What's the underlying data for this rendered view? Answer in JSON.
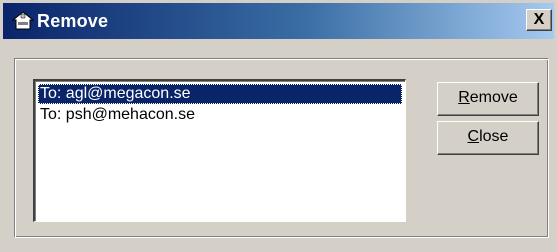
{
  "window": {
    "title": "Remove",
    "close_glyph": "X",
    "icon": "remove-user-icon"
  },
  "list": {
    "items": [
      {
        "label": "To: agl@megacon.se",
        "selected": true
      },
      {
        "label": "To: psh@mehacon.se",
        "selected": false
      }
    ]
  },
  "buttons": {
    "remove": {
      "accel": "R",
      "rest": "emove"
    },
    "close": {
      "accel": "C",
      "rest": "lose"
    }
  },
  "colors": {
    "titlebar_start": "#0a246a",
    "titlebar_end": "#a6caf0",
    "face": "#d4d0c8",
    "selection": "#0a246a"
  }
}
